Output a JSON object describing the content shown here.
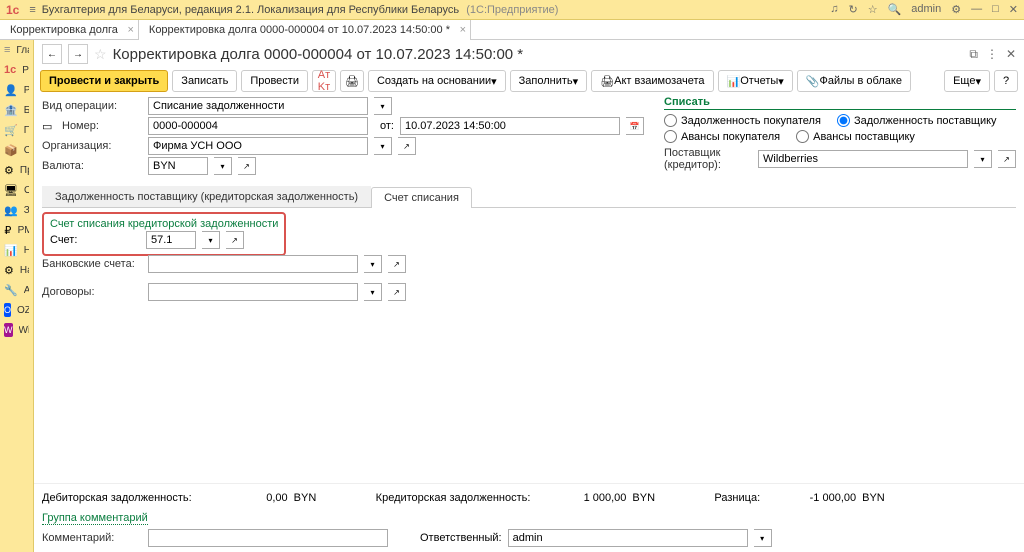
{
  "titlebar": {
    "app": "Бухгалтерия для Беларуси, редакция 2.1. Локализация для Республики Беларусь",
    "platform": "(1С:Предприятие)",
    "user": "admin"
  },
  "tabs": [
    {
      "label": "Корректировка долга"
    },
    {
      "label": "Корректировка долга 0000-000004 от 10.07.2023 14:50:00 *"
    }
  ],
  "sidebar": [
    {
      "icon": "≡",
      "label": "Главное"
    },
    {
      "icon": "1c",
      "label": "PO.BY"
    },
    {
      "icon": "👤",
      "label": "Руководителю"
    },
    {
      "icon": "🏦",
      "label": "Банк и касса"
    },
    {
      "icon": "🛒",
      "label": "Покупки и продажи"
    },
    {
      "icon": "📦",
      "label": "Склад"
    },
    {
      "icon": "⚙",
      "label": "Производство"
    },
    {
      "icon": "🖥",
      "label": "ОС и НМА"
    },
    {
      "icon": "👥",
      "label": "Зарплата и кадры"
    },
    {
      "icon": "₽",
      "label": "РМК"
    },
    {
      "icon": "📊",
      "label": "Налоги и отчетность"
    },
    {
      "icon": "⚙",
      "label": "Настройки учета"
    },
    {
      "icon": "🔧",
      "label": "Администрирование"
    },
    {
      "icon": "O",
      "label": "OZON"
    },
    {
      "icon": "W",
      "label": "Wildberries"
    }
  ],
  "doc": {
    "title": "Корректировка долга 0000-000004 от 10.07.2023 14:50:00 *"
  },
  "toolbar": {
    "main_action": "Провести и закрыть",
    "write": "Записать",
    "post": "Провести",
    "create_basis": "Создать на основании",
    "fill": "Заполнить",
    "act": "Акт взаимозачета",
    "reports": "Отчеты",
    "files": "Файлы в облаке",
    "more": "Еще"
  },
  "form": {
    "op_type_label": "Вид операции:",
    "op_type_value": "Списание задолженности",
    "number_label": "Номер:",
    "number_value": "0000-000004",
    "from_label": "от:",
    "date_value": "10.07.2023 14:50:00",
    "org_label": "Организация:",
    "org_value": "Фирма УСН ООО",
    "currency_label": "Валюта:",
    "currency_value": "BYN",
    "writeoff_legend": "Списать",
    "radio1": "Задолженность покупателя",
    "radio2": "Задолженность поставщику",
    "radio3": "Авансы покупателя",
    "radio4": "Авансы поставщику",
    "supplier_label": "Поставщик (кредитор):",
    "supplier_value": "Wildberries"
  },
  "inner_tabs": {
    "tab1": "Задолженность поставщику (кредиторская задолженность)",
    "tab2": "Счет списания"
  },
  "account_box": {
    "legend": "Счет списания кредиторской задолженности",
    "account_label": "Счет:",
    "account_value": "57.1",
    "bank_label": "Банковские счета:",
    "contracts_label": "Договоры:"
  },
  "footer": {
    "debit_label": "Дебиторская задолженность:",
    "debit_value": "0,00",
    "credit_label": "Кредиторская задолженность:",
    "credit_value": "1 000,00",
    "diff_label": "Разница:",
    "diff_value": "-1 000,00",
    "currency": "BYN",
    "group_link": "Группа комментарий",
    "comment_label": "Комментарий:",
    "responsible_label": "Ответственный:",
    "responsible_value": "admin"
  }
}
